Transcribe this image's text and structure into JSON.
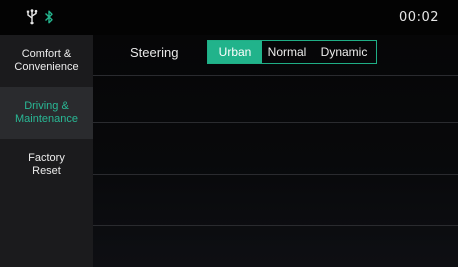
{
  "status_bar": {
    "time": "00:02",
    "icons": [
      "usb-icon",
      "bluetooth-icon"
    ]
  },
  "sidebar": {
    "items": [
      {
        "label": "Comfort &\nConvenience",
        "active": false
      },
      {
        "label": "Driving &\nMaintenance",
        "active": true
      },
      {
        "label": "Factory\nReset",
        "active": false
      }
    ]
  },
  "main": {
    "steering": {
      "label": "Steering",
      "options": [
        "Urban",
        "Normal",
        "Dynamic"
      ],
      "selected": "Urban"
    }
  },
  "colors": {
    "accent": "#21b38b",
    "accent_text": "#29b895",
    "sidebar_bg": "#1b1b1d",
    "sidebar_active_bg": "#2a2b2e",
    "background": "#050506"
  }
}
